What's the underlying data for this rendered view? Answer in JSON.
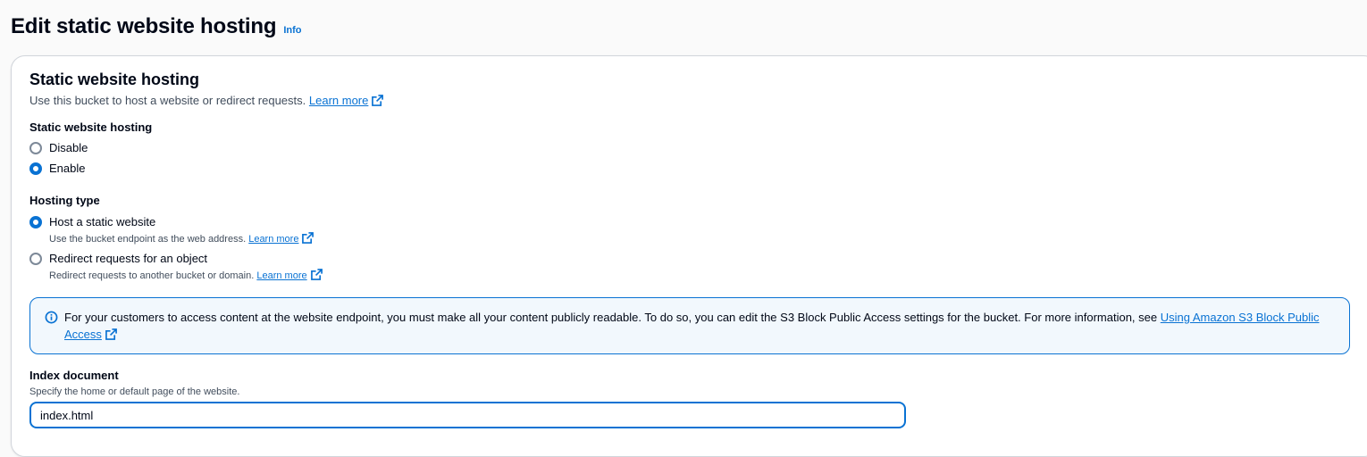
{
  "header": {
    "title": "Edit static website hosting",
    "info_label": "Info"
  },
  "section": {
    "title": "Static website hosting",
    "description": "Use this bucket to host a website or redirect requests.",
    "learn_more": "Learn more"
  },
  "hosting": {
    "label": "Static website hosting",
    "options": [
      {
        "label": "Disable",
        "selected": false
      },
      {
        "label": "Enable",
        "selected": true
      }
    ]
  },
  "hosting_type": {
    "label": "Hosting type",
    "options": [
      {
        "label": "Host a static website",
        "description": "Use the bucket endpoint as the web address.",
        "learn_more": "Learn more",
        "selected": true
      },
      {
        "label": "Redirect requests for an object",
        "description": "Redirect requests to another bucket or domain.",
        "learn_more": "Learn more",
        "selected": false
      }
    ]
  },
  "alert": {
    "text": "For your customers to access content at the website endpoint, you must make all your content publicly readable. To do so, you can edit the S3 Block Public Access settings for the bucket. For more information, see",
    "link": "Using Amazon S3 Block Public Access"
  },
  "index_document": {
    "label": "Index document",
    "hint": "Specify the home or default page of the website.",
    "value": "index.html"
  },
  "colors": {
    "accent": "#0972d3",
    "alert_bg": "#f2f8fd",
    "text": "#000716"
  }
}
